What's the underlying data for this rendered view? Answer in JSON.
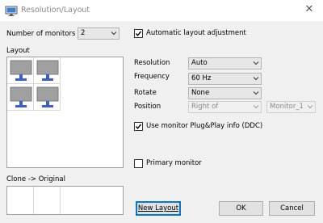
{
  "window": {
    "title": "Resolution/Layout",
    "icon": "monitor-layout-icon",
    "close_icon": "close-icon"
  },
  "monitors": {
    "label": "Number of monitors",
    "value": "2"
  },
  "auto_layout": {
    "label": "Automatic layout adjustment",
    "checked": true
  },
  "layout": {
    "label": "Layout",
    "monitor_icon": "monitor-icon",
    "monitor_count_shown": 4
  },
  "settings": {
    "resolution": {
      "label": "Resolution",
      "value": "Auto"
    },
    "frequency": {
      "label": "Frequency",
      "value": "60 Hz"
    },
    "rotate": {
      "label": "Rotate",
      "value": "None"
    },
    "position": {
      "label": "Position",
      "value": "Right of",
      "target": "Monitor_1",
      "disabled": true
    }
  },
  "plug_play": {
    "label": "Use monitor Plug&Play info (DDC)",
    "checked": true
  },
  "primary": {
    "label": "Primary monitor",
    "checked": false
  },
  "clone": {
    "label": "Clone -> Original"
  },
  "buttons": {
    "new_layout": "New Layout",
    "ok": "OK",
    "cancel": "Cancel"
  },
  "colors": {
    "accent": "#0078d7",
    "monitor_screen": "#a0a0a0",
    "monitor_stand": "#3a5fcd"
  }
}
